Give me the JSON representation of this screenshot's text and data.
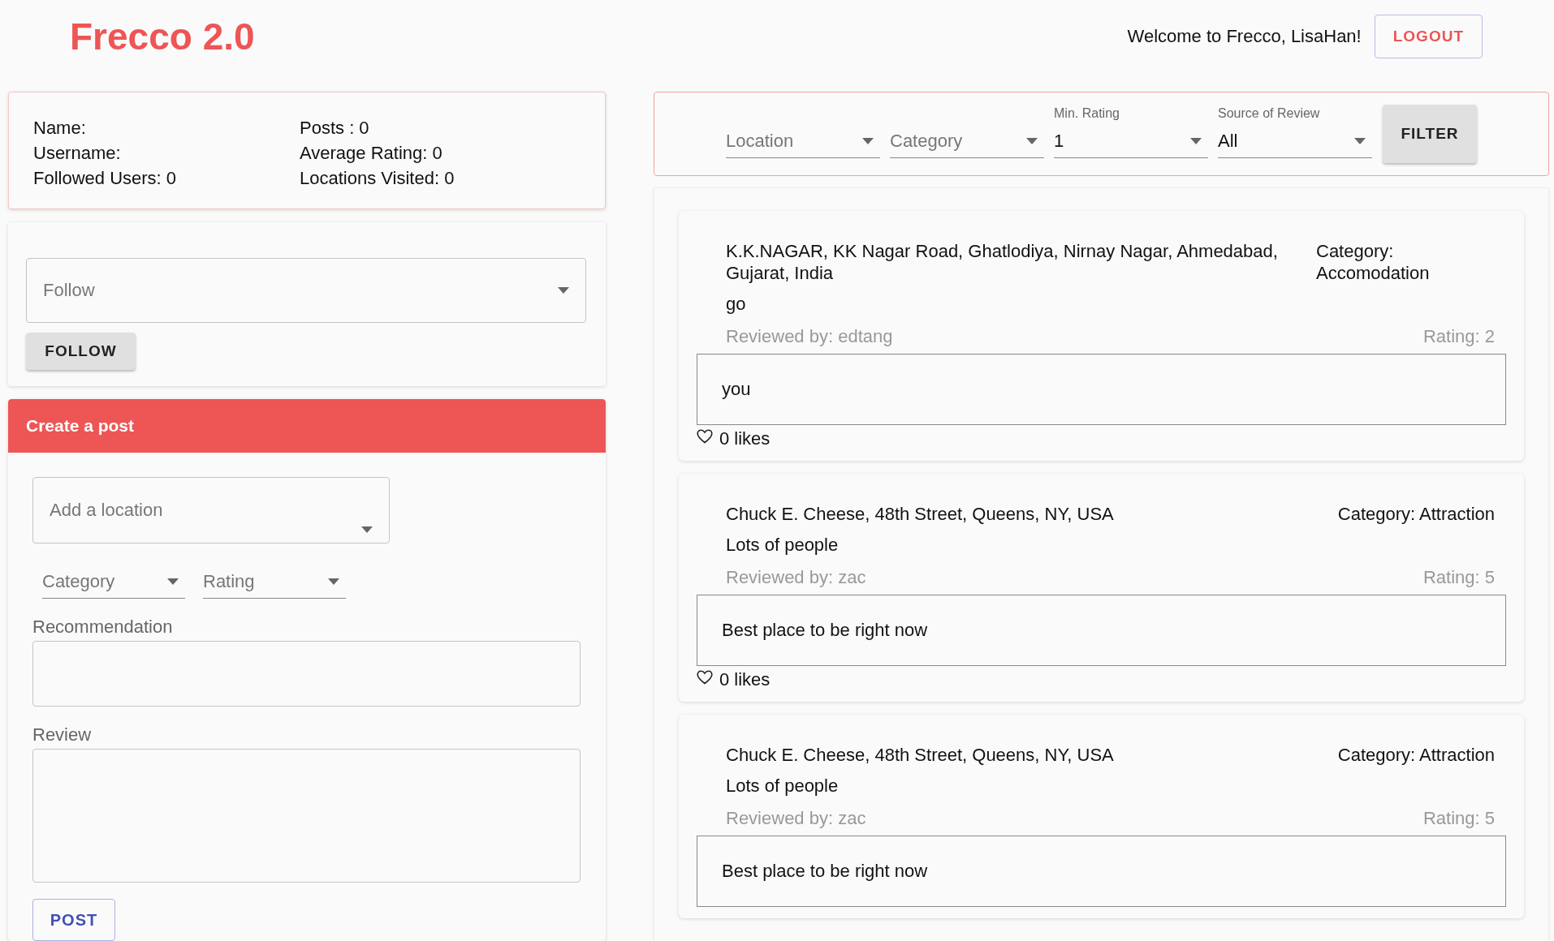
{
  "header": {
    "title": "Frecco 2.0",
    "welcome": "Welcome to Frecco, LisaHan!",
    "logout": "LOGOUT"
  },
  "profile": {
    "left": [
      "Name:",
      "Username:",
      "Followed Users: 0"
    ],
    "right": [
      "Posts : 0",
      "Average Rating: 0",
      "Locations Visited: 0"
    ]
  },
  "follow": {
    "placeholder": "Follow",
    "button": "FOLLOW"
  },
  "create_post": {
    "title": "Create a post",
    "location": {
      "placeholder": "Add a location"
    },
    "category": {
      "placeholder": "Category"
    },
    "rating": {
      "placeholder": "Rating"
    },
    "recommendation_label": "Recommendation",
    "review_label": "Review",
    "button": "POST"
  },
  "filters": {
    "fields": [
      {
        "placeholder": "Location"
      },
      {
        "placeholder": "Category"
      },
      {
        "label": "Min. Rating",
        "value": "1"
      },
      {
        "label": "Source of Review",
        "value": "All"
      }
    ],
    "button": "FILTER"
  },
  "posts": [
    {
      "location": "K.K.NAGAR, KK Nagar Road, Ghatlodiya, Nirnay Nagar, Ahmedabad, Gujarat, India",
      "category": "Category: Accomodation",
      "recommendation": "go",
      "reviewed_by": "Reviewed by: edtang",
      "rating": "Rating: 2",
      "review": "you",
      "likes": "0 likes"
    },
    {
      "location": "Chuck E. Cheese, 48th Street, Queens, NY, USA",
      "category": "Category: Attraction",
      "recommendation": "Lots of people",
      "reviewed_by": "Reviewed by: zac",
      "rating": "Rating: 5",
      "review": "Best place to be right now",
      "likes": "0 likes"
    },
    {
      "location": "Chuck E. Cheese, 48th Street, Queens, NY, USA",
      "category": "Category: Attraction",
      "recommendation": "Lots of people",
      "reviewed_by": "Reviewed by: zac",
      "rating": "Rating: 5",
      "review": "Best place to be right now"
    }
  ]
}
